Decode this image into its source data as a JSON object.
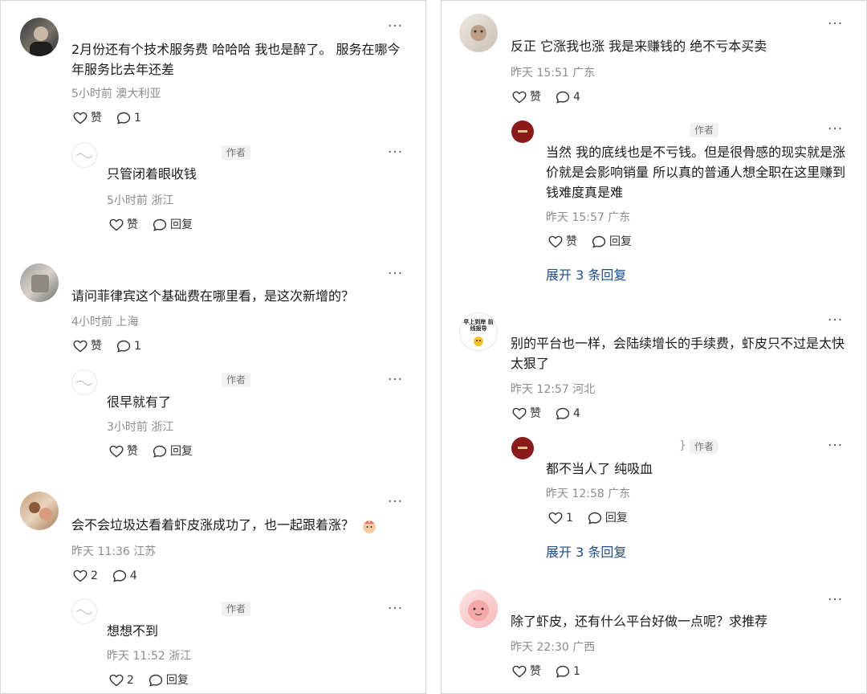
{
  "left": {
    "c1": {
      "text": "2月份还有个技术服务费 哈哈哈 我也是醉了。 服务在哪今年服务比去年还差",
      "meta": "5小时前 澳大利亚",
      "like": "赞",
      "comments": "1",
      "reply": {
        "text": "只管闭着眼收钱",
        "tag": "作者",
        "meta": "5小时前 浙江",
        "like": "赞",
        "reply_label": "回复"
      }
    },
    "c2": {
      "text": "请问菲律宾这个基础费在哪里看，是这次新增的？",
      "meta": "4小时前 上海",
      "like": "赞",
      "comments": "1",
      "reply": {
        "text": "很早就有了",
        "tag": "作者",
        "meta": "3小时前 浙江",
        "like": "赞",
        "reply_label": "回复"
      }
    },
    "c3": {
      "text": "会不会垃圾达看着虾皮涨成功了，也一起跟着涨？",
      "meta": "昨天 11:36 江苏",
      "likes": "2",
      "comments": "4",
      "reply": {
        "text": "想想不到",
        "tag": "作者",
        "meta": "昨天 11:52 浙江",
        "likes": "2",
        "reply_label": "回复"
      }
    }
  },
  "right": {
    "c1": {
      "text": "反正 它涨我也涨 我是来赚钱的 绝不亏本买卖",
      "meta": "昨天 15:51 广东",
      "like": "赞",
      "comments": "4",
      "reply": {
        "text": "当然 我的底线也是不亏钱。但是很骨感的现实就是涨价就是会影响销量 所以真的普通人想全职在这里赚到钱难度真是难",
        "tag": "作者",
        "meta": "昨天 15:57 广东",
        "like": "赞",
        "reply_label": "回复"
      },
      "expand": "展开 3 条回复"
    },
    "c2": {
      "avatar_text": "早上到岸 前线报导",
      "text": "别的平台也一样，会陆续增长的手续费，虾皮只不过是太快太狠了",
      "meta": "昨天 12:57 河北",
      "like": "赞",
      "comments": "4",
      "reply": {
        "name_fragment": "}",
        "text": "都不当人了 纯吸血",
        "tag": "作者",
        "meta": "昨天 12:58 广东",
        "likes": "1",
        "reply_label": "回复"
      },
      "expand": "展开 3 条回复"
    },
    "c3": {
      "text": "除了虾皮，还有什么平台好做一点呢？求推荐",
      "meta": "昨天 22:30 广西",
      "like": "赞",
      "comments": "1"
    }
  },
  "more_glyph": "···"
}
